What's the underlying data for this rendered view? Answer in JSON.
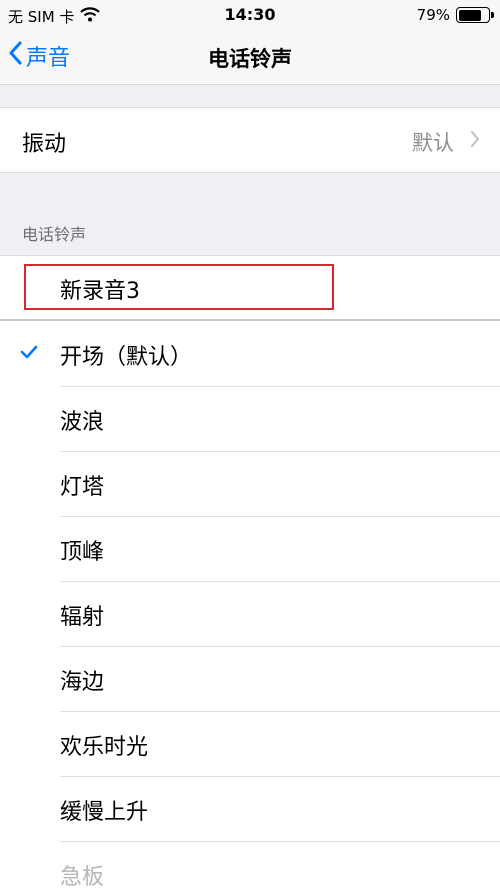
{
  "status_bar": {
    "carrier": "无 SIM 卡",
    "time": "14:30",
    "battery_text": "79%",
    "battery_level": 0.79
  },
  "nav": {
    "back_label": "声音",
    "title": "电话铃声"
  },
  "vibration": {
    "label": "振动",
    "value": "默认"
  },
  "ringtones": {
    "section_title": "电话铃声",
    "custom": [
      "新录音3"
    ],
    "items": [
      "开场（默认）",
      "波浪",
      "灯塔",
      "顶峰",
      "辐射",
      "海边",
      "欢乐时光",
      "缓慢上升",
      "急板"
    ],
    "selected": "开场（默认）"
  },
  "colors": {
    "accent": "#007aff",
    "highlight": "#d9262c"
  }
}
